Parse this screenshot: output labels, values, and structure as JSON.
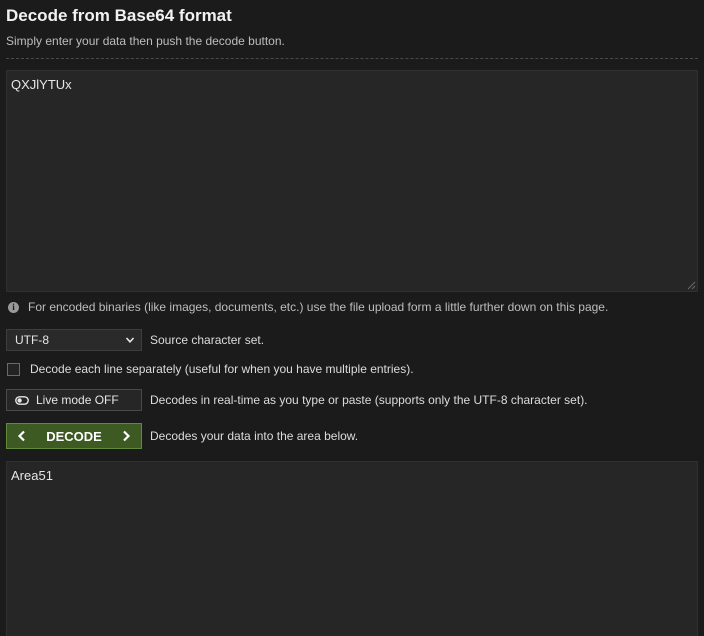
{
  "header": {
    "title": "Decode from Base64 format",
    "subtitle": "Simply enter your data then push the decode button."
  },
  "input": {
    "value": "QXJlYTUx"
  },
  "info": {
    "text": "For encoded binaries (like images, documents, etc.) use the file upload form a little further down on this page."
  },
  "charset": {
    "selected": "UTF-8",
    "label": "Source character set."
  },
  "separate_lines": {
    "label": "Decode each line separately (useful for when you have multiple entries)."
  },
  "live_mode": {
    "button_label": "Live mode OFF",
    "description": "Decodes in real-time as you type or paste (supports only the UTF-8 character set)."
  },
  "decode": {
    "button_label": "DECODE",
    "description": "Decodes your data into the area below."
  },
  "output": {
    "value": "Area51"
  },
  "colors": {
    "background": "#1b1b1b",
    "textarea": "#262626",
    "decode_button": "#3c5a22"
  }
}
